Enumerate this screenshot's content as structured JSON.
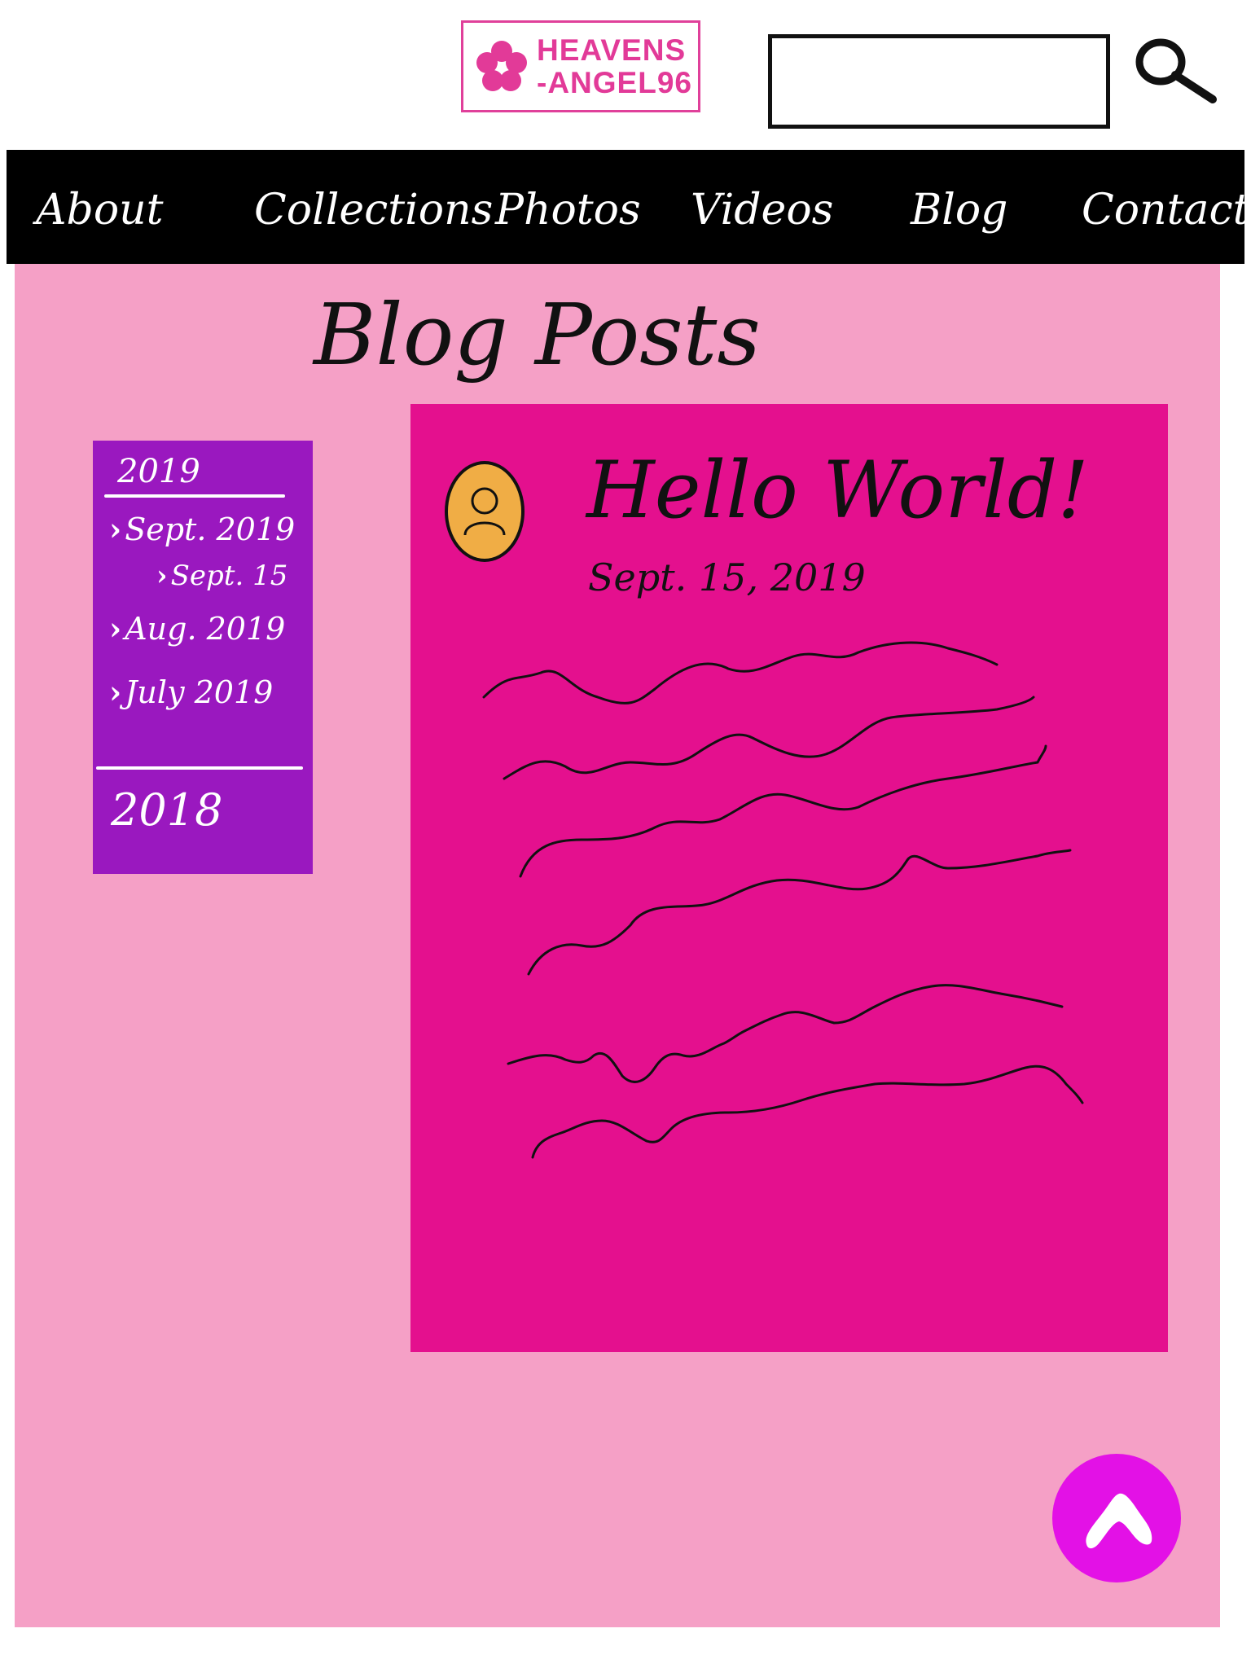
{
  "header": {
    "logo": {
      "line1": "HEAVENS",
      "line2": "-ANGEL96",
      "icon": "flower-icon",
      "color": "#e23a98"
    },
    "search": {
      "placeholder": "",
      "value": "",
      "button_icon": "search-icon"
    }
  },
  "nav": {
    "items": [
      {
        "label": "About"
      },
      {
        "label": "Collections"
      },
      {
        "label": "Photos"
      },
      {
        "label": "Videos"
      },
      {
        "label": "Blog"
      },
      {
        "label": "Contact"
      }
    ]
  },
  "page": {
    "title": "Blog Posts",
    "background": "#f5a0c6"
  },
  "sidebar": {
    "background": "#9a18bf",
    "year_2019": "2019",
    "links": [
      {
        "label": "Sept. 2019"
      },
      {
        "label": "Sept. 15"
      },
      {
        "label": "Aug. 2019"
      },
      {
        "label": "July 2019"
      }
    ],
    "year_2018": "2018"
  },
  "post": {
    "background": "#e4108e",
    "avatar_icon": "user-icon",
    "title": "Hello World!",
    "date": "Sept. 15, 2019"
  },
  "scroll_top": {
    "icon": "arrow-up-icon",
    "color": "#e311e6"
  }
}
